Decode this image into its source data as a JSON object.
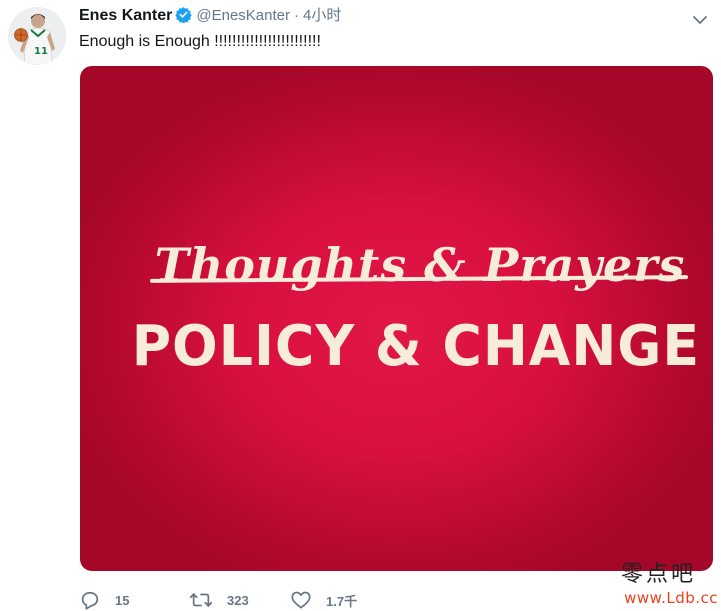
{
  "tweet": {
    "display_name": "Enes Kanter",
    "verified": true,
    "handle": "@EnesKanter",
    "separator": "·",
    "time": "4小时",
    "text": "Enough is Enough !!!!!!!!!!!!!!!!!!!!!!!!",
    "avatar_jersey_number": "11"
  },
  "media": {
    "struck_text": "Thoughts & Prayers",
    "main_text": "POLICY & CHANGE",
    "background_color": "#d81040",
    "text_color": "#f7ecd8"
  },
  "actions": {
    "reply": {
      "icon": "reply-icon",
      "count": "15"
    },
    "retweet": {
      "icon": "retweet-icon",
      "count": "323"
    },
    "like": {
      "icon": "heart-icon",
      "count": "1.7千"
    }
  },
  "watermark": {
    "text_cn": "零点吧",
    "url": "www.Ldb.cc"
  },
  "colors": {
    "secondary_text": "#657786",
    "verified_badge": "#1da1f2",
    "watermark_url": "#e8411c"
  }
}
